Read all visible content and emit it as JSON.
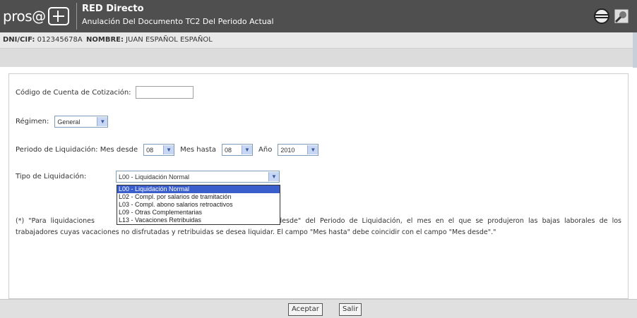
{
  "header": {
    "logo_text": "pros@",
    "app_title": "RED Directo",
    "app_subtitle": "Anulación Del Documento TC2 Del Periodo Actual",
    "icons": [
      "globe-icon",
      "settings-icon"
    ]
  },
  "userbar": {
    "dni_label": "DNI/CIF:",
    "dni_value": "012345678A",
    "name_label": "NOMBRE:",
    "name_value": "JUAN ESPAÑOL ESPAÑOL"
  },
  "form": {
    "ccc_label": "Código de Cuenta de Cotización:",
    "ccc_value": "",
    "regimen_label": "Régimen:",
    "regimen_value": "General",
    "periodo_label": "Periodo de Liquidación: Mes desde",
    "mes_desde_value": "08",
    "mes_hasta_label": "Mes hasta",
    "mes_hasta_value": "08",
    "anio_label": "Año",
    "anio_value": "2010",
    "tipo_label": "Tipo de Liquidación:",
    "tipo_value": "L00 - Liquidación Normal",
    "tipo_options": [
      "L00 - Liquidación Normal",
      "L02 - Compl. por salarios de tramitación",
      "L03 - Compl. abono salarios retroactivos",
      "L09 - Otras Complementarias",
      "L13 - Vacaciones Retribuidas"
    ],
    "note_start": "(*) \"Para liquidaciones",
    "note_end": "Mes desde\" del Periodo de Liquidación, el mes en el que se produjeron las bajas laborales de los trabajadores cuyas vacaciones no disfrutadas y retribuidas se desea liquidar. El campo \"Mes hasta\" debe coincidir con el campo \"Mes desde\".\""
  },
  "footer": {
    "accept_label": "Aceptar",
    "exit_label": "Salir"
  }
}
